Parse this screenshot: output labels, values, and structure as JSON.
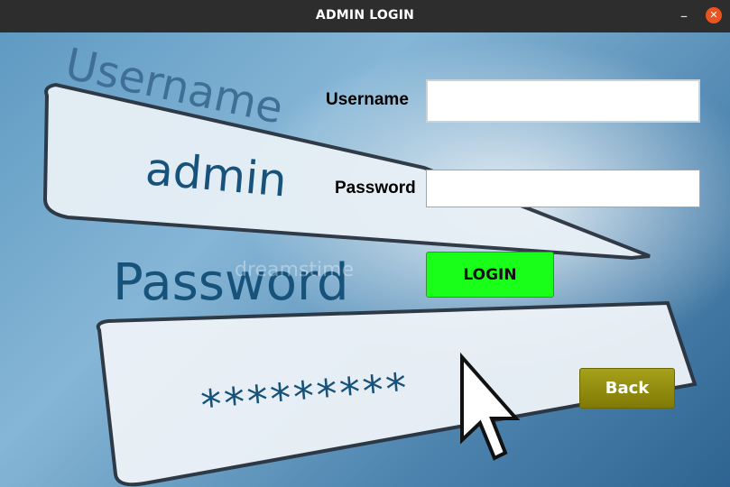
{
  "window": {
    "title": "ADMIN LOGIN",
    "minimize_glyph": "–",
    "close_glyph": "✕"
  },
  "background": {
    "username_word": "Username",
    "admin_word": "admin",
    "password_word": "Password",
    "masked_password": "*********",
    "watermark": "dreamstime",
    "colors": {
      "sky_light": "#86b6d6",
      "sky_dark": "#2f6491",
      "ink": "#17527a"
    }
  },
  "form": {
    "username_label": "Username",
    "username_value": "",
    "password_label": "Password",
    "password_value": "",
    "login_label": "LOGIN",
    "back_label": "Back",
    "colors": {
      "login": "#19ff19",
      "back": "#8f8a0e"
    }
  }
}
